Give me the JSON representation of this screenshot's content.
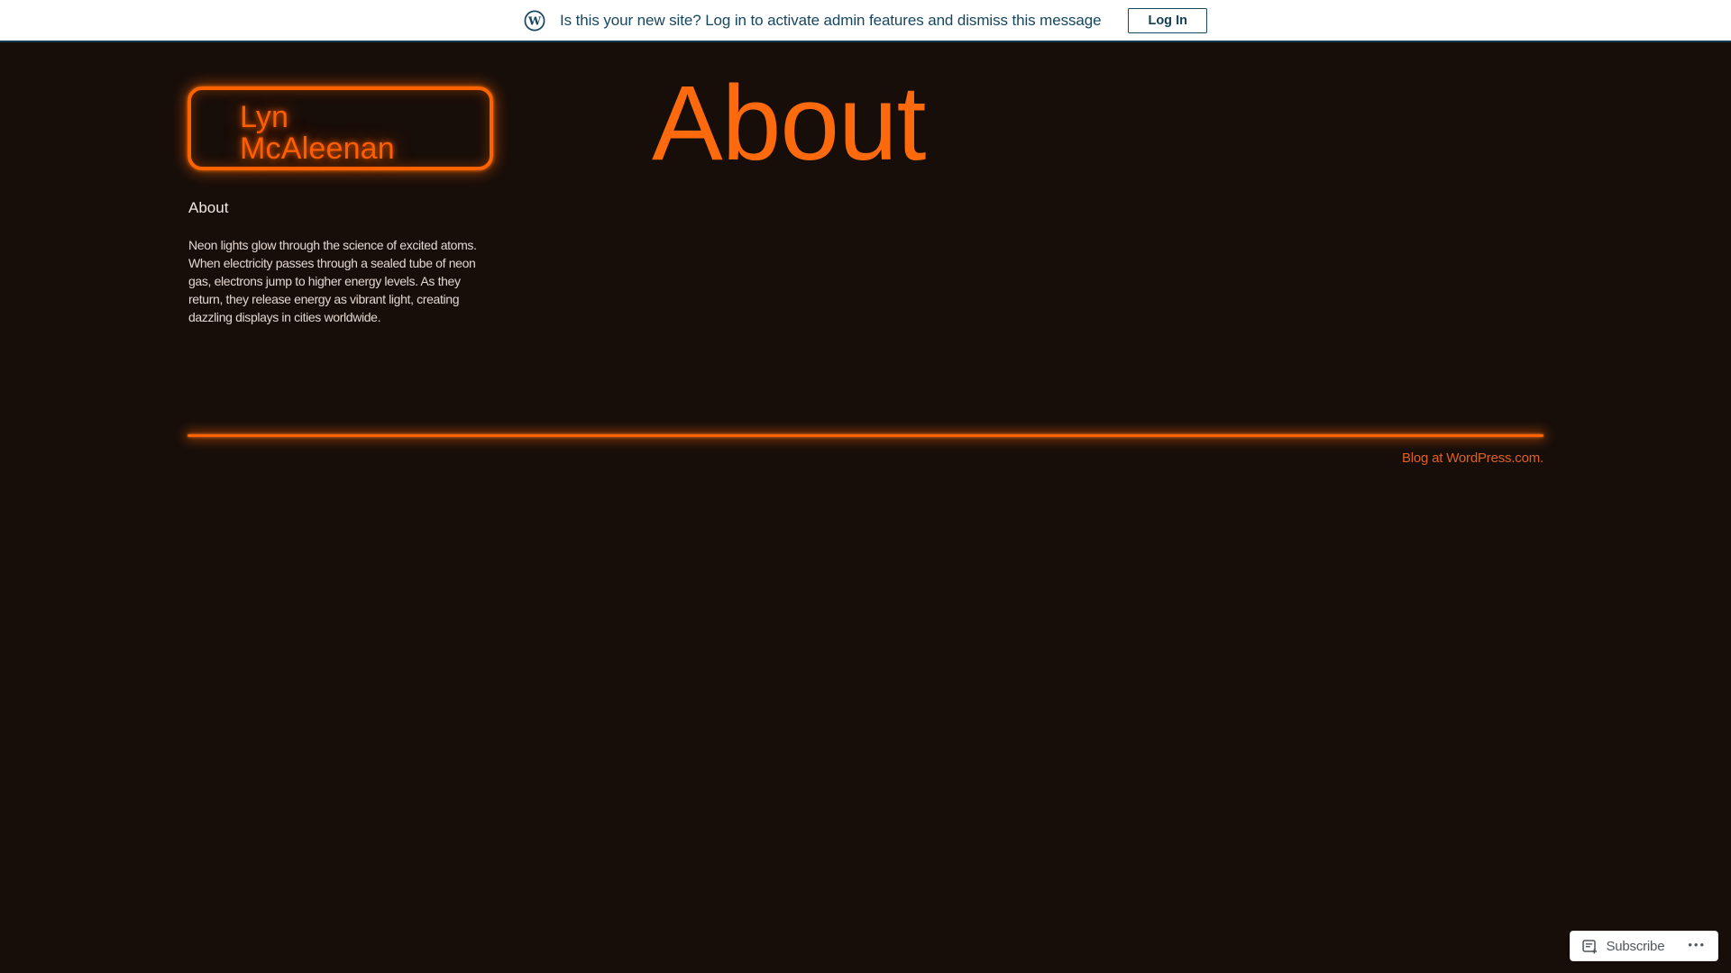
{
  "banner": {
    "message": "Is this your new site? Log in to activate admin features and dismiss this message",
    "login_label": "Log In",
    "ink_color": "#16475e",
    "background": "#ffffff",
    "icons": {
      "wordpress_logo": "circled-W wordpress mark"
    }
  },
  "site": {
    "title": "Lyn McAleenan",
    "nav": [
      {
        "label": "About"
      }
    ],
    "intro": "Neon lights glow through the science of excited atoms. When electricity passes through a sealed tube of neon gas, electrons jump to higher energy levels. As they return, they release energy as vibrant light, creating dazzling displays in cities worldwide.",
    "neon_color": "#ff6200",
    "background": "#170e0a",
    "body_text_color": "#e4d7cf"
  },
  "page": {
    "title": "About",
    "title_color": "#fd6a0e"
  },
  "footer": {
    "credit": "Blog at WordPress.com.",
    "credit_color": "#df6120"
  },
  "subscribe": {
    "label": "Subscribe",
    "ellipsis": "•••",
    "icons": {
      "subscribe": "document-with-plus",
      "more_options": "three-dots ellipsis"
    }
  }
}
